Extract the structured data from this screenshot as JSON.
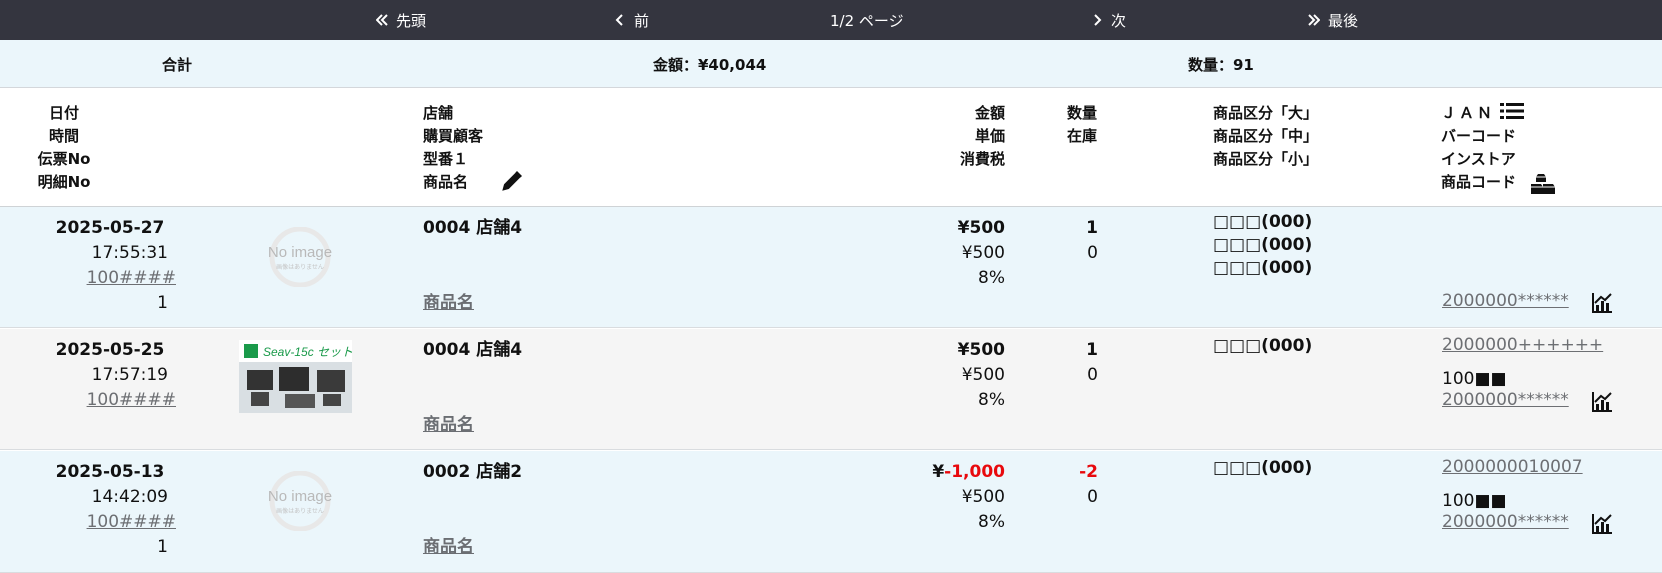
{
  "pager": {
    "first": "先頭",
    "prev": "前",
    "info": "1/2 ページ",
    "next": "次",
    "last": "最後"
  },
  "totals": {
    "label": "合計",
    "amount": "金額：¥40,044",
    "quantity": "数量：91"
  },
  "header": {
    "col_date": [
      "日付",
      "時間",
      "伝票No",
      "明細No"
    ],
    "col_store": [
      "店舗",
      "購買顧客",
      "型番１",
      "商品名"
    ],
    "col_amount": [
      "金額",
      "単価",
      "消費税"
    ],
    "col_qty": [
      "数量",
      "在庫"
    ],
    "col_category": [
      "商品区分「大」",
      "商品区分「中」",
      "商品区分「小」"
    ],
    "col_code": [
      "ＪＡＮ",
      "バーコード",
      "インストア",
      "商品コード"
    ]
  },
  "rows": [
    {
      "date": "2025-05-27",
      "time": "17:55:31",
      "slip": "100####",
      "line": "1",
      "image": "No image",
      "image_sub": "画像はありません",
      "store": "0004 店舗4",
      "product": "商品名",
      "amount": "¥500",
      "unit": "¥500",
      "tax": "8%",
      "qty": "1",
      "stock": "0",
      "cat1": "□□□(000)",
      "cat2": "□□□(000)",
      "cat3": "□□□(000)",
      "code": "2000000******"
    },
    {
      "date": "2025-05-25",
      "time": "17:57:19",
      "slip": "100####",
      "image": "Seav-15c セット",
      "store": "0004 店舗4",
      "product": "商品名",
      "amount": "¥500",
      "unit": "¥500",
      "tax": "8%",
      "qty": "1",
      "stock": "0",
      "cat1": "□□□(000)",
      "jan": "2000000++++++",
      "instore": "100■■",
      "code": "2000000******"
    },
    {
      "date": "2025-05-13",
      "time": "14:42:09",
      "slip": "100####",
      "line": "1",
      "image": "No image",
      "image_sub": "画像はありません",
      "store": "0002 店舗2",
      "product": "商品名",
      "amount_prefix": "¥",
      "amount": "-1,000",
      "unit": "¥500",
      "tax": "8%",
      "qty": "-2",
      "stock": "0",
      "cat1": "□□□(000)",
      "jan": "2000000010007",
      "instore": "100■■",
      "code": "2000000******"
    }
  ],
  "colors": {
    "pager_bg": "#34353f",
    "row_blue": "#ebf6fb",
    "row_gray": "#f5f5f5",
    "negative": "#e8090d"
  }
}
